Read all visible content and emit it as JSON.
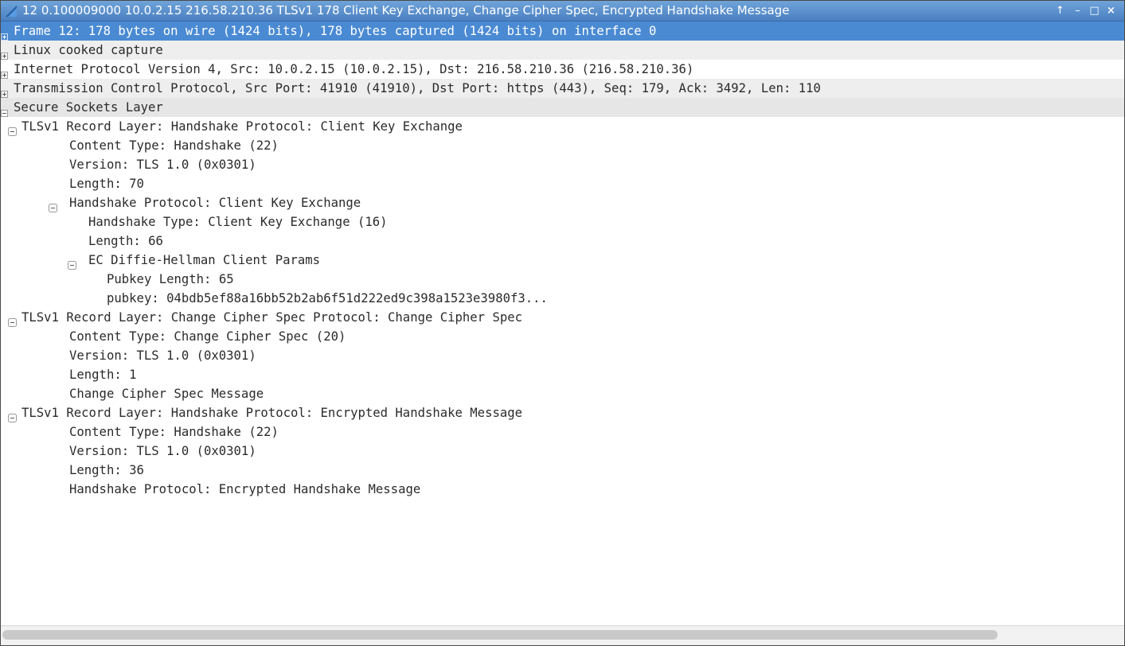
{
  "window": {
    "title": "12 0.100009000 10.0.2.15 216.58.210.36 TLSv1 178 Client Key Exchange, Change Cipher Spec, Encrypted Handshake Message",
    "icons": [
      "wireshark-fin-icon",
      "keep-above-icon",
      "minimize-icon",
      "maximize-icon",
      "close-icon"
    ],
    "buttons": {
      "up": "↑",
      "minimize": "–",
      "maximize": "□",
      "close": "×"
    }
  },
  "tree": {
    "rows": [
      {
        "text": "Frame 12: 178 bytes on wire (1424 bits), 178 bytes captured (1424 bits) on interface 0",
        "expander": "plus"
      },
      {
        "text": "Linux cooked capture",
        "expander": "plus"
      },
      {
        "text": "Internet Protocol Version 4, Src: 10.0.2.15 (10.0.2.15), Dst: 216.58.210.36 (216.58.210.36)",
        "expander": "plus"
      },
      {
        "text": "Transmission Control Protocol, Src Port: 41910 (41910), Dst Port: https (443), Seq: 179, Ack: 3492, Len: 110",
        "expander": "plus"
      },
      {
        "text": "Secure Sockets Layer",
        "expander": "minus"
      },
      {
        "text": "TLSv1 Record Layer: Handshake Protocol: Client Key Exchange",
        "expander": "minus"
      },
      {
        "text": "Content Type: Handshake (22)",
        "expander": ""
      },
      {
        "text": "Version: TLS 1.0 (0x0301)",
        "expander": ""
      },
      {
        "text": "Length: 70",
        "expander": ""
      },
      {
        "text": "Handshake Protocol: Client Key Exchange",
        "expander": "minus"
      },
      {
        "text": "Handshake Type: Client Key Exchange (16)",
        "expander": ""
      },
      {
        "text": "Length: 66",
        "expander": ""
      },
      {
        "text": "EC Diffie-Hellman Client Params",
        "expander": "minus"
      },
      {
        "text": "Pubkey Length: 65",
        "expander": ""
      },
      {
        "text": "pubkey: 04bdb5ef88a16bb52b2ab6f51d222ed9c398a1523e3980f3...",
        "expander": ""
      },
      {
        "text": "TLSv1 Record Layer: Change Cipher Spec Protocol: Change Cipher Spec",
        "expander": "minus"
      },
      {
        "text": "Content Type: Change Cipher Spec (20)",
        "expander": ""
      },
      {
        "text": "Version: TLS 1.0 (0x0301)",
        "expander": ""
      },
      {
        "text": "Length: 1",
        "expander": ""
      },
      {
        "text": "Change Cipher Spec Message",
        "expander": ""
      },
      {
        "text": "TLSv1 Record Layer: Handshake Protocol: Encrypted Handshake Message",
        "expander": "minus"
      },
      {
        "text": "Content Type: Handshake (22)",
        "expander": ""
      },
      {
        "text": "Version: TLS 1.0 (0x0301)",
        "expander": ""
      },
      {
        "text": "Length: 36",
        "expander": ""
      },
      {
        "text": "Handshake Protocol: Encrypted Handshake Message",
        "expander": ""
      }
    ]
  },
  "colors": {
    "selection": "#4a8ad3",
    "titlebar": "#4a80c1",
    "alt_row": "#eeeeee",
    "text": "#2b2b2b"
  }
}
